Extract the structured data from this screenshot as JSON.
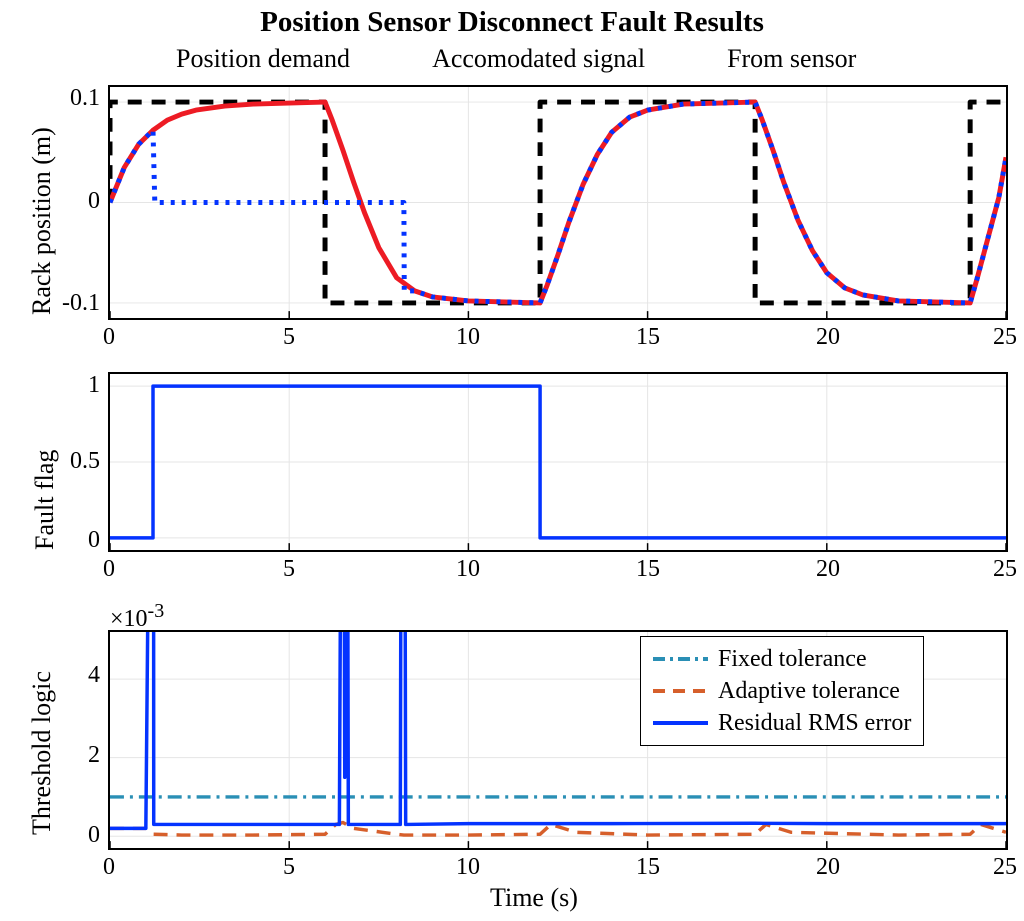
{
  "title": "Position Sensor Disconnect Fault Results",
  "legend_top": {
    "demand": "Position demand",
    "accom": "Accomodated signal",
    "sensor": "From sensor"
  },
  "axes": {
    "rack_y": "Rack position (m)",
    "fault_y": "Fault flag",
    "thresh_y": "Threshold logic",
    "time_x": "Time (s)",
    "exp": "×10"
  },
  "legend_thresh": {
    "fixed": "Fixed tolerance",
    "adaptive": "Adaptive tolerance",
    "residual": "Residual RMS error"
  },
  "ticks": {
    "xt": [
      "0",
      "5",
      "10",
      "15",
      "20",
      "25"
    ],
    "y1": [
      "-0.1",
      "0",
      "0.1"
    ],
    "y2": [
      "0",
      "0.5",
      "1"
    ],
    "y3": [
      "0",
      "2",
      "4"
    ],
    "exp_sup": "-3"
  },
  "colors": {
    "black": "#000000",
    "red": "#ed1b24",
    "blue": "#0433ff",
    "grid": "#e6e6e6",
    "teal": "#2a8fb5",
    "orange": "#d65f2b"
  },
  "chart_data": [
    {
      "type": "line",
      "title": "Rack position (m)",
      "xlabel": "Time (s)",
      "ylabel": "Rack position (m)",
      "xlim": [
        0,
        25
      ],
      "ylim": [
        -0.115,
        0.115
      ],
      "series": [
        {
          "name": "Position demand",
          "style": "black-dash",
          "x": [
            0,
            0,
            6,
            6,
            12,
            12,
            18,
            18,
            24,
            24,
            25
          ],
          "y": [
            0,
            0.1,
            0.1,
            -0.1,
            -0.1,
            0.1,
            0.1,
            -0.1,
            -0.1,
            0.1,
            0.1
          ]
        },
        {
          "name": "Accomodated signal",
          "style": "red-solid",
          "x": [
            0,
            0.4,
            0.8,
            1.2,
            1.6,
            2.0,
            2.4,
            2.8,
            3.2,
            3.6,
            4.0,
            5.0,
            6.0,
            6.2,
            6.5,
            6.8,
            7.1,
            7.5,
            8.0,
            8.5,
            9.0,
            10.0,
            11.0,
            12.0,
            12.2,
            12.5,
            12.8,
            13.2,
            13.6,
            14.0,
            14.5,
            15.0,
            16.0,
            17.0,
            18.0,
            18.2,
            18.5,
            18.8,
            19.2,
            19.6,
            20.0,
            20.5,
            21.0,
            22.0,
            23.0,
            24.0,
            24.2,
            24.5,
            24.8,
            25.0
          ],
          "y": [
            0.0,
            0.035,
            0.058,
            0.072,
            0.082,
            0.088,
            0.092,
            0.094,
            0.096,
            0.097,
            0.098,
            0.099,
            0.1,
            0.082,
            0.052,
            0.02,
            -0.01,
            -0.045,
            -0.075,
            -0.088,
            -0.094,
            -0.098,
            -0.099,
            -0.1,
            -0.082,
            -0.052,
            -0.02,
            0.018,
            0.048,
            0.07,
            0.085,
            0.092,
            0.098,
            0.099,
            0.1,
            0.082,
            0.052,
            0.02,
            -0.018,
            -0.048,
            -0.07,
            -0.085,
            -0.092,
            -0.098,
            -0.099,
            -0.1,
            -0.075,
            -0.035,
            0.005,
            0.045
          ]
        },
        {
          "name": "From sensor",
          "style": "blue-dot",
          "x": [
            0,
            0.4,
            0.8,
            1.2,
            1.25,
            8.2,
            8.21,
            8.5,
            9.0,
            10.0,
            11.0,
            12.0,
            12.2,
            12.5,
            12.8,
            13.2,
            13.6,
            14.0,
            14.5,
            15.0,
            16.0,
            17.0,
            18.0,
            18.2,
            18.5,
            18.8,
            19.2,
            19.6,
            20.0,
            20.5,
            21.0,
            22.0,
            23.0,
            24.0,
            24.2,
            24.5,
            24.8,
            25.0
          ],
          "y": [
            0.0,
            0.035,
            0.058,
            0.072,
            0.0,
            0.0,
            -0.088,
            -0.088,
            -0.094,
            -0.098,
            -0.099,
            -0.1,
            -0.082,
            -0.052,
            -0.02,
            0.018,
            0.048,
            0.07,
            0.085,
            0.092,
            0.098,
            0.099,
            0.1,
            0.082,
            0.052,
            0.02,
            -0.018,
            -0.048,
            -0.07,
            -0.085,
            -0.092,
            -0.098,
            -0.099,
            -0.1,
            -0.075,
            -0.035,
            0.005,
            0.045
          ]
        }
      ]
    },
    {
      "type": "line",
      "title": "Fault flag",
      "xlabel": "Time (s)",
      "ylabel": "Fault flag",
      "xlim": [
        0,
        25
      ],
      "ylim": [
        -0.08,
        1.08
      ],
      "series": [
        {
          "name": "Fault flag",
          "style": "blue-solid",
          "x": [
            0,
            1.2,
            1.2,
            12.0,
            12.0,
            25
          ],
          "y": [
            0,
            0,
            1,
            1,
            0,
            0
          ]
        }
      ]
    },
    {
      "type": "line",
      "title": "Threshold logic",
      "xlabel": "Time (s)",
      "ylabel": "Threshold logic",
      "xlim": [
        0,
        25
      ],
      "ylim": [
        -0.0003,
        0.0052
      ],
      "y_exponent": -3,
      "series": [
        {
          "name": "Fixed tolerance",
          "style": "teal-dashdot",
          "x": [
            0,
            25
          ],
          "y": [
            0.001,
            0.001
          ]
        },
        {
          "name": "Adaptive tolerance",
          "style": "orange-dash",
          "x": [
            0,
            1.0,
            1.2,
            2.0,
            4.0,
            6.0,
            6.3,
            6.5,
            6.8,
            8.0,
            8.2,
            10.0,
            12.0,
            12.3,
            13.0,
            15.0,
            18.0,
            18.3,
            19.0,
            22.0,
            24.0,
            24.3,
            25.0
          ],
          "y": [
            0.0002,
            0.0002,
            5e-05,
            3e-05,
            3e-05,
            5e-05,
            0.0003,
            0.00035,
            0.0002,
            5e-05,
            3e-05,
            3e-05,
            5e-05,
            0.0003,
            0.0001,
            3e-05,
            5e-05,
            0.0003,
            0.0001,
            3e-05,
            5e-05,
            0.0003,
            0.0001
          ]
        },
        {
          "name": "Residual RMS error",
          "style": "blue-solid",
          "x": [
            0,
            1.0,
            1.2,
            1.21,
            1.22,
            6.4,
            6.5,
            6.55,
            6.6,
            6.65,
            8.1,
            8.15,
            8.2,
            8.25,
            8.3,
            10.0,
            12.0,
            14.0,
            18.0,
            20.0,
            25.0
          ],
          "y": [
            0.0002,
            0.0002,
            0.02,
            0.02,
            0.0003,
            0.0003,
            0.02,
            0.0015,
            0.02,
            0.0003,
            0.0003,
            0.02,
            0.02,
            0.0003,
            0.0003,
            0.00032,
            0.00032,
            0.00032,
            0.00033,
            0.00032,
            0.00032
          ]
        }
      ]
    }
  ]
}
